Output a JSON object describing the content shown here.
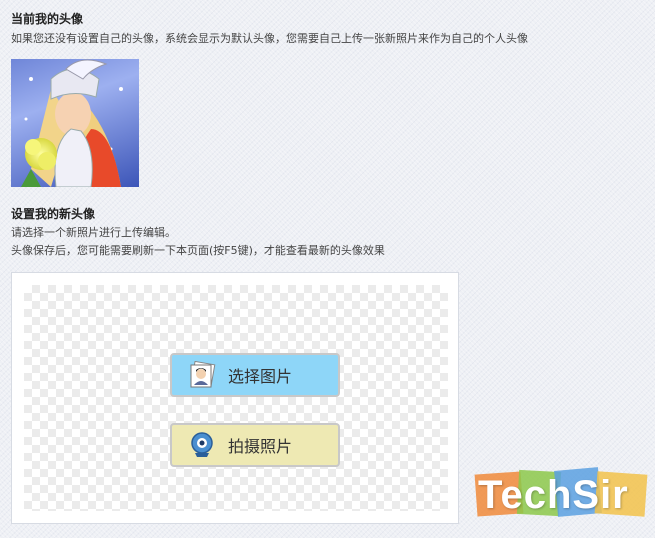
{
  "current_avatar": {
    "heading": "当前我的头像",
    "note": "如果您还没有设置自己的头像，系统会显示为默认头像，您需要自己上传一张新照片来作为自己的个人头像"
  },
  "new_avatar": {
    "heading": "设置我的新头像",
    "line1": "请选择一个新照片进行上传编辑。",
    "line2": "头像保存后，您可能需要刷新一下本页面(按F5键)，才能查看最新的头像效果",
    "select_button": "选择图片",
    "camera_button": "拍摄照片"
  },
  "watermark": "TechSir"
}
